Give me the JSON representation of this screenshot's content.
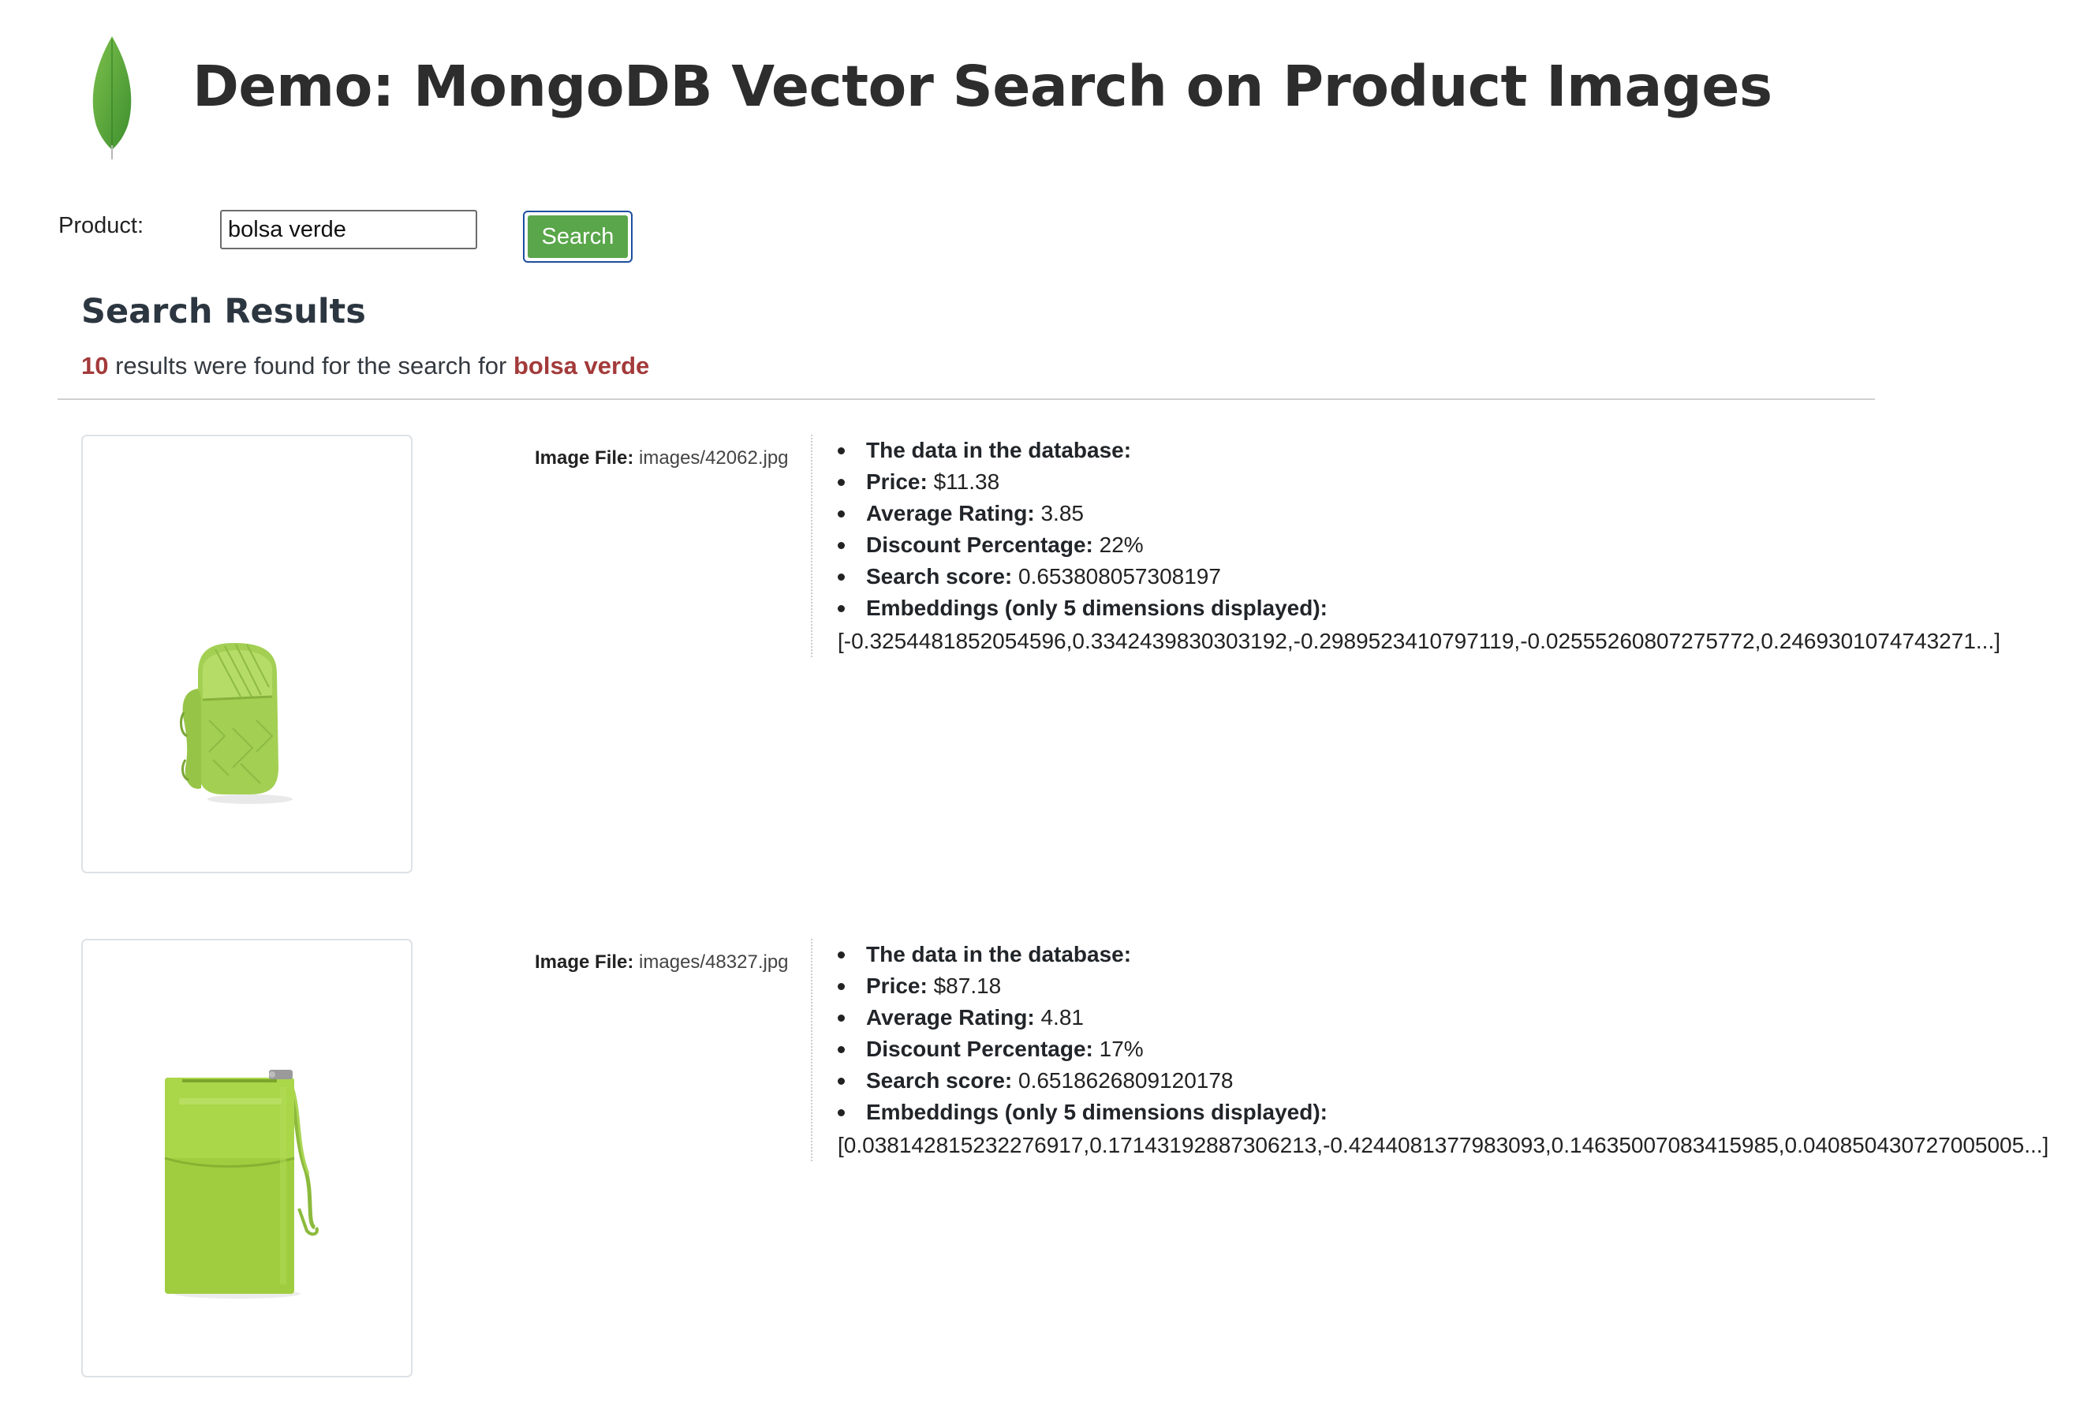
{
  "header": {
    "title": "Demo: MongoDB Vector Search on Product Images"
  },
  "search": {
    "label": "Product:",
    "value": "bolsa verde",
    "button_label": "Search"
  },
  "results": {
    "heading": "Search Results",
    "count": "10",
    "summary_middle": " results were found for the search for ",
    "query": "bolsa verde",
    "items": [
      {
        "image_file_label": "Image File:",
        "image_file": "images/42062.jpg",
        "data_heading": "The data in the database:",
        "price_label": "Price:",
        "price": "$11.38",
        "rating_label": "Average Rating:",
        "rating": "3.85",
        "discount_label": "Discount Percentage:",
        "discount": "22%",
        "score_label": "Search score:",
        "score": "0.653808057308197",
        "embeddings_label": "Embeddings (only 5 dimensions displayed):",
        "embeddings": "[-0.3254481852054596,0.3342439830303192,-0.2989523410797119,-0.02555260807275772,0.2469301074743271...]"
      },
      {
        "image_file_label": "Image File:",
        "image_file": "images/48327.jpg",
        "data_heading": "The data in the database:",
        "price_label": "Price:",
        "price": "$87.18",
        "rating_label": "Average Rating:",
        "rating": "4.81",
        "discount_label": "Discount Percentage:",
        "discount": "17%",
        "score_label": "Search score:",
        "score": "0.6518626809120178",
        "embeddings_label": "Embeddings (only 5 dimensions displayed):",
        "embeddings": "[0.038142815232276917,0.17143192887306213,-0.4244081377983093,0.14635007083415985,0.040850430727005005...]"
      }
    ]
  },
  "colors": {
    "accent": "#a33a3a",
    "button": "#5aa64a",
    "leaf": "#4fa33c"
  }
}
